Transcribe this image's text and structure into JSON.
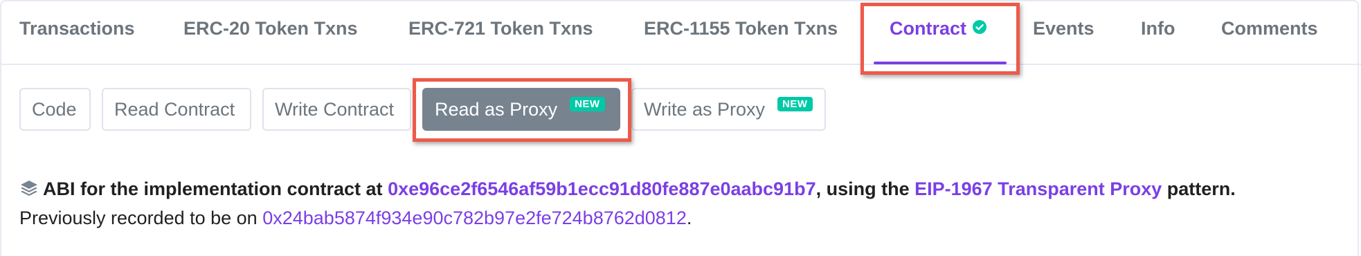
{
  "tabs": {
    "transactions": "Transactions",
    "erc20": "ERC-20 Token Txns",
    "erc721": "ERC-721 Token Txns",
    "erc1155": "ERC-1155 Token Txns",
    "contract": "Contract",
    "events": "Events",
    "info": "Info",
    "comments": "Comments",
    "active": "Contract"
  },
  "subtabs": {
    "code": "Code",
    "read_contract": "Read Contract",
    "write_contract": "Write Contract",
    "read_as_proxy": "Read as Proxy",
    "write_as_proxy": "Write as Proxy",
    "new_badge": "NEW",
    "active": "Read as Proxy"
  },
  "abi_info": {
    "prefix": "ABI for the implementation contract at",
    "implementation_address": "0xe96ce2f6546af59b1ecc91d80fe887e0aabc91b7",
    "middle": ", using the",
    "proxy_pattern": "EIP-1967 Transparent Proxy",
    "suffix": "pattern.",
    "previous_prefix": "Previously recorded to be on",
    "previous_address": "0x24bab5874f934e90c782b97e2fe724b8762d0812",
    "previous_suffix": "."
  },
  "colors": {
    "accent": "#7b3fe4",
    "tab_text": "#6c757d",
    "active_button_bg": "#77838f",
    "badge": "#00c9a7",
    "highlight": "#ee5a4a",
    "verified": "#00c9a7"
  },
  "icons": {
    "verified": "check-circle-icon",
    "abi": "layers-icon"
  }
}
